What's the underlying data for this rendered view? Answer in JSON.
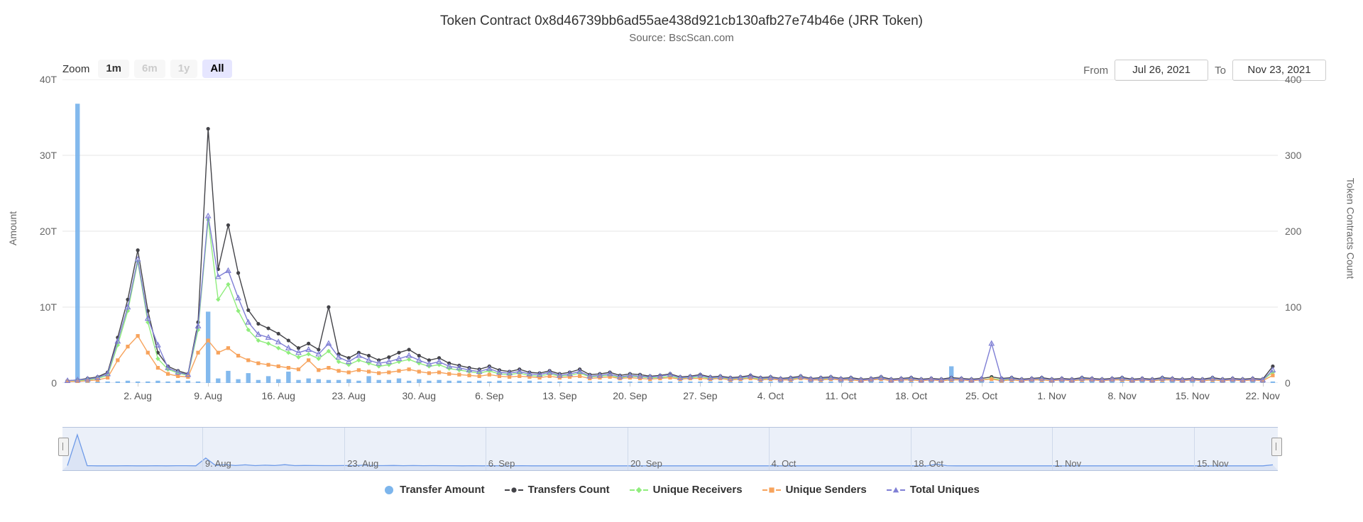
{
  "header": {
    "title": "Token Contract 0x8d46739bb6ad55ae438d921cb130afb27e74b46e (JRR Token)",
    "subtitle": "Source: BscScan.com"
  },
  "range_selector": {
    "label": "Zoom",
    "buttons": [
      {
        "label": "1m",
        "state": "enabled"
      },
      {
        "label": "6m",
        "state": "disabled"
      },
      {
        "label": "1y",
        "state": "disabled"
      },
      {
        "label": "All",
        "state": "selected"
      }
    ],
    "from_label": "From",
    "from_value": "Jul 26, 2021",
    "to_label": "To",
    "to_value": "Nov 23, 2021"
  },
  "chart_data": {
    "type": "line",
    "title": "Token Contract 0x8d46739bb6ad55ae438d921cb130afb27e74b46e (JRR Token)",
    "subtitle": "Source: BscScan.com",
    "xlabel": "",
    "ylabel": "Amount",
    "y2label": "Token Contracts Count",
    "ylim": [
      0,
      40
    ],
    "y2lim": [
      0,
      400
    ],
    "y_ticks": [
      "0",
      "10T",
      "20T",
      "30T",
      "40T"
    ],
    "y_tick_values": [
      0,
      10,
      20,
      30,
      40
    ],
    "y2_ticks": [
      "0",
      "100",
      "200",
      "300",
      "400"
    ],
    "y2_tick_values": [
      0,
      100,
      200,
      300,
      400
    ],
    "grid": true,
    "legend_position": "bottom",
    "x_tick_labels": [
      "2. Aug",
      "9. Aug",
      "16. Aug",
      "23. Aug",
      "30. Aug",
      "6. Sep",
      "13. Sep",
      "20. Sep",
      "27. Sep",
      "4. Oct",
      "11. Oct",
      "18. Oct",
      "25. Oct",
      "1. Nov",
      "8. Nov",
      "15. Nov",
      "22. Nov"
    ],
    "x_tick_positions": [
      7,
      14,
      21,
      28,
      35,
      42,
      49,
      56,
      63,
      70,
      77,
      84,
      91,
      98,
      105,
      112,
      119
    ],
    "x_start_date": "2021-07-26",
    "x_end_date": "2021-11-23",
    "x_days": 121,
    "series": [
      {
        "name": "Transfer Amount",
        "type": "column",
        "axis": "left",
        "color": "#7cb5ec",
        "units": "T",
        "values": [
          0.4,
          36.8,
          0.3,
          0.2,
          0.2,
          0.2,
          0.3,
          0.2,
          0.2,
          0.3,
          0.2,
          0.3,
          0.3,
          0.2,
          9.4,
          0.6,
          1.6,
          0.5,
          1.3,
          0.4,
          0.9,
          0.5,
          1.5,
          0.4,
          0.6,
          0.5,
          0.4,
          0.4,
          0.5,
          0.3,
          0.9,
          0.4,
          0.4,
          0.6,
          0.3,
          0.5,
          0.3,
          0.4,
          0.3,
          0.3,
          0.2,
          0.3,
          0.2,
          0.3,
          0.2,
          0.2,
          0.3,
          0.2,
          0.2,
          0.2,
          0.2,
          0.2,
          0.2,
          0.2,
          0.2,
          0.2,
          0.2,
          0.2,
          0.2,
          0.2,
          0.2,
          0.2,
          0.2,
          0.2,
          0.2,
          0.2,
          0.2,
          0.2,
          0.2,
          0.2,
          0.2,
          0.2,
          0.2,
          0.2,
          0.2,
          0.2,
          0.2,
          0.2,
          0.2,
          0.2,
          0.2,
          0.2,
          0.2,
          0.2,
          0.2,
          0.2,
          0.2,
          0.2,
          2.2,
          0.3,
          0.2,
          0.2,
          0.2,
          0.2,
          0.2,
          0.2,
          0.2,
          0.2,
          0.2,
          0.2,
          0.2,
          0.2,
          0.2,
          0.2,
          0.2,
          0.2,
          0.2,
          0.2,
          0.2,
          0.2,
          0.2,
          0.2,
          0.2,
          0.2,
          0.2,
          0.2,
          0.2,
          0.2,
          0.2,
          0.2,
          0.2,
          0.2,
          1.3
        ]
      },
      {
        "name": "Transfers Count",
        "type": "line",
        "axis": "right",
        "color": "#434348",
        "values": [
          3,
          4,
          6,
          8,
          14,
          60,
          110,
          175,
          95,
          40,
          22,
          16,
          12,
          80,
          335,
          150,
          208,
          145,
          96,
          78,
          72,
          65,
          56,
          46,
          52,
          44,
          100,
          38,
          33,
          40,
          36,
          30,
          34,
          40,
          44,
          36,
          30,
          33,
          26,
          23,
          20,
          18,
          22,
          17,
          15,
          18,
          14,
          13,
          16,
          12,
          14,
          18,
          11,
          12,
          14,
          10,
          12,
          11,
          9,
          10,
          12,
          8,
          9,
          11,
          8,
          9,
          7,
          8,
          10,
          7,
          8,
          6,
          7,
          9,
          6,
          7,
          8,
          6,
          7,
          5,
          6,
          8,
          5,
          6,
          7,
          5,
          6,
          5,
          7,
          6,
          5,
          6,
          8,
          6,
          7,
          5,
          6,
          7,
          5,
          6,
          5,
          7,
          6,
          5,
          6,
          7,
          5,
          6,
          5,
          7,
          6,
          5,
          6,
          5,
          7,
          5,
          6,
          5,
          6,
          5,
          22
        ]
      },
      {
        "name": "Unique Receivers",
        "type": "line",
        "axis": "right",
        "color": "#90ed7d",
        "values": [
          2,
          3,
          4,
          6,
          10,
          50,
          95,
          160,
          80,
          32,
          18,
          13,
          10,
          70,
          215,
          110,
          130,
          95,
          70,
          56,
          52,
          46,
          40,
          34,
          38,
          32,
          42,
          28,
          24,
          30,
          26,
          22,
          24,
          28,
          31,
          26,
          22,
          24,
          19,
          17,
          15,
          13,
          16,
          12,
          11,
          13,
          10,
          9,
          12,
          9,
          10,
          13,
          8,
          9,
          10,
          7,
          9,
          8,
          7,
          7,
          9,
          6,
          7,
          8,
          6,
          7,
          5,
          6,
          7,
          5,
          6,
          4,
          5,
          7,
          4,
          5,
          6,
          4,
          5,
          4,
          4,
          6,
          4,
          4,
          5,
          4,
          4,
          4,
          5,
          4,
          4,
          4,
          6,
          4,
          5,
          4,
          4,
          5,
          4,
          4,
          4,
          5,
          4,
          4,
          4,
          5,
          4,
          4,
          4,
          5,
          4,
          4,
          4,
          4,
          5,
          4,
          4,
          4,
          4,
          4,
          14
        ]
      },
      {
        "name": "Unique Senders",
        "type": "line",
        "axis": "right",
        "color": "#f7a35c",
        "values": [
          2,
          2,
          3,
          4,
          7,
          30,
          48,
          62,
          40,
          20,
          12,
          9,
          8,
          40,
          56,
          40,
          46,
          36,
          30,
          26,
          24,
          22,
          20,
          18,
          30,
          17,
          20,
          16,
          14,
          17,
          15,
          13,
          14,
          16,
          18,
          15,
          13,
          14,
          12,
          11,
          10,
          9,
          11,
          9,
          8,
          9,
          8,
          7,
          9,
          7,
          8,
          9,
          6,
          7,
          8,
          6,
          7,
          6,
          5,
          6,
          7,
          5,
          6,
          6,
          5,
          6,
          4,
          5,
          6,
          4,
          5,
          4,
          4,
          6,
          4,
          4,
          5,
          4,
          4,
          3,
          4,
          5,
          3,
          4,
          4,
          3,
          4,
          3,
          4,
          4,
          3,
          4,
          5,
          3,
          4,
          3,
          4,
          4,
          3,
          4,
          3,
          4,
          4,
          3,
          4,
          4,
          3,
          4,
          3,
          4,
          4,
          3,
          4,
          3,
          4,
          3,
          4,
          3,
          4,
          3,
          10
        ]
      },
      {
        "name": "Total Uniques",
        "type": "line",
        "axis": "right",
        "color": "#7f7fd5",
        "values": [
          3,
          4,
          5,
          7,
          12,
          55,
          100,
          163,
          85,
          50,
          20,
          14,
          11,
          75,
          220,
          140,
          148,
          112,
          80,
          64,
          60,
          54,
          46,
          40,
          44,
          38,
          52,
          34,
          28,
          36,
          30,
          26,
          28,
          32,
          36,
          30,
          25,
          28,
          22,
          20,
          17,
          15,
          19,
          14,
          13,
          15,
          12,
          11,
          14,
          10,
          12,
          15,
          9,
          10,
          12,
          8,
          10,
          9,
          8,
          9,
          11,
          7,
          8,
          10,
          7,
          8,
          6,
          7,
          9,
          6,
          7,
          5,
          6,
          8,
          5,
          6,
          7,
          5,
          6,
          4,
          5,
          7,
          4,
          5,
          6,
          4,
          5,
          4,
          6,
          5,
          4,
          5,
          52,
          5,
          6,
          4,
          5,
          6,
          4,
          5,
          4,
          6,
          5,
          4,
          5,
          6,
          4,
          5,
          4,
          6,
          5,
          4,
          5,
          4,
          6,
          4,
          5,
          4,
          5,
          4,
          17
        ]
      }
    ]
  },
  "navigator": {
    "x_tick_labels": [
      "9. Aug",
      "23. Aug",
      "6. Sep",
      "20. Sep",
      "4. Oct",
      "18. Oct",
      "1. Nov",
      "15. Nov"
    ],
    "x_tick_positions": [
      11.5,
      23.2,
      34.8,
      46.5,
      58.1,
      69.8,
      81.4,
      93.1
    ]
  },
  "legend": {
    "items": [
      {
        "label": "Transfer Amount",
        "color": "#7cb5ec",
        "marker": "circle"
      },
      {
        "label": "Transfers Count",
        "color": "#434348",
        "marker": "circle-line"
      },
      {
        "label": "Unique Receivers",
        "color": "#90ed7d",
        "marker": "diamond-line"
      },
      {
        "label": "Unique Senders",
        "color": "#f7a35c",
        "marker": "square-line"
      },
      {
        "label": "Total Uniques",
        "color": "#7f7fd5",
        "marker": "triangle-line"
      }
    ]
  }
}
